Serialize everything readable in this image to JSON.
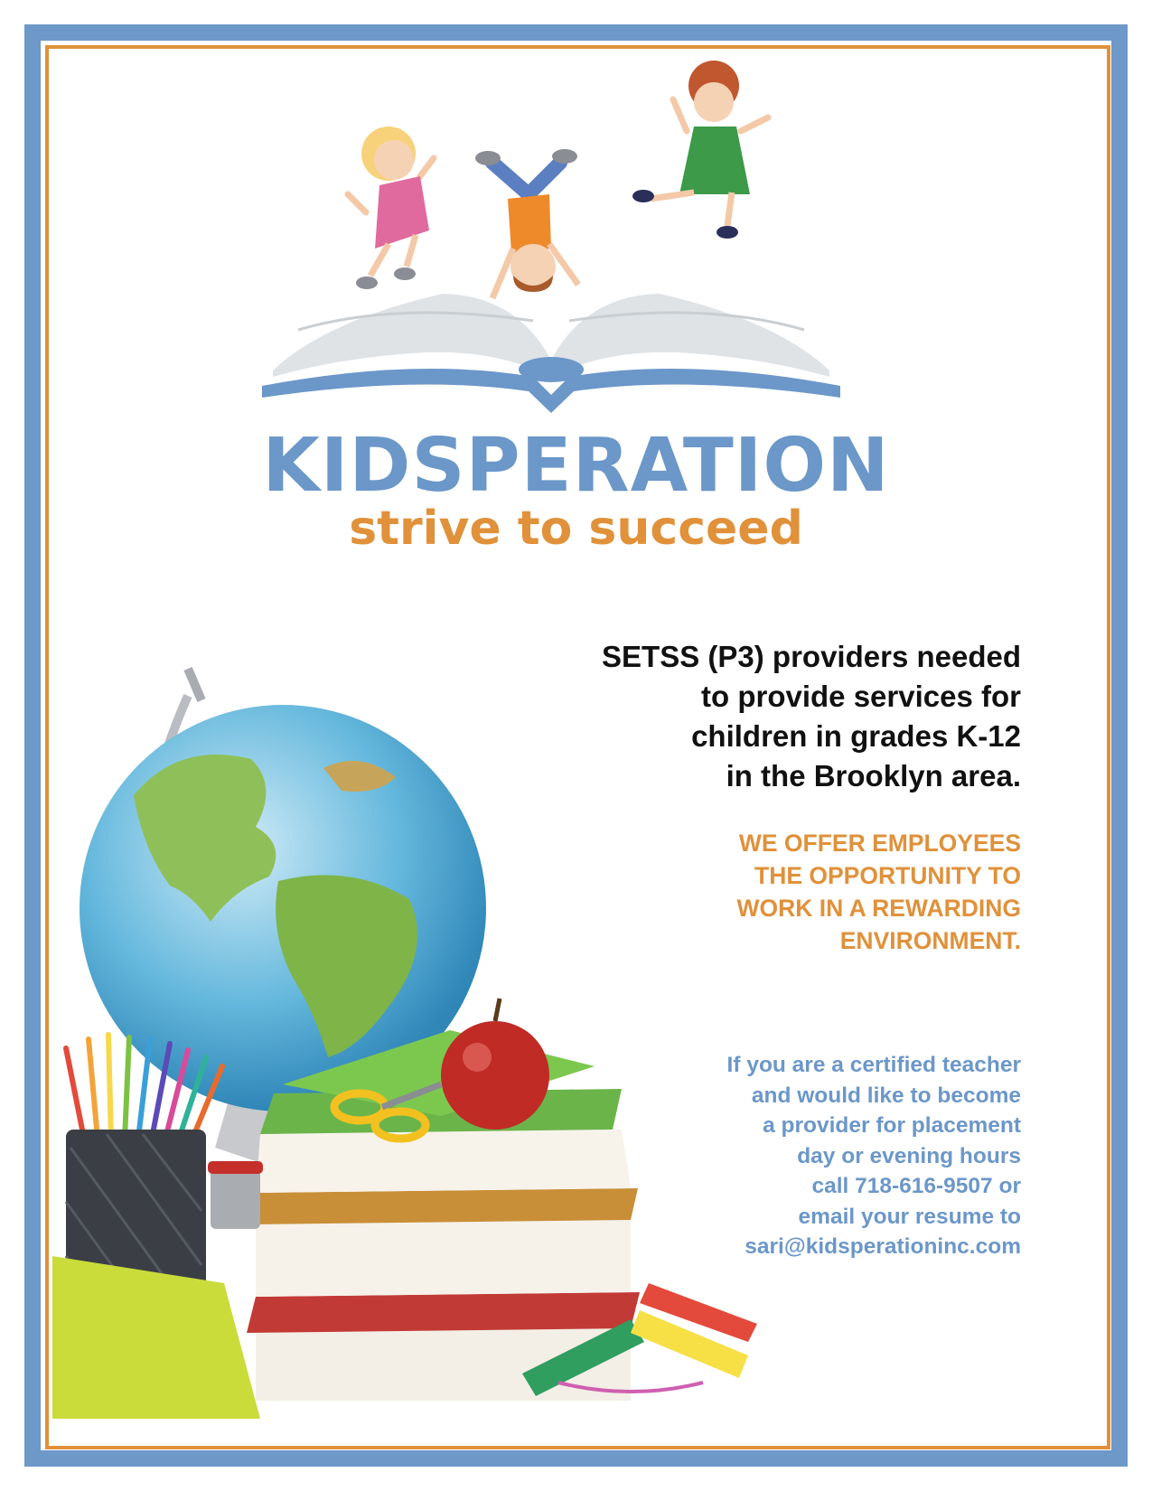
{
  "colors": {
    "frame_blue": "#6d98c8",
    "frame_orange": "#e0913a",
    "brand_blue": "#6b97c9",
    "accent_orange": "#e0913a",
    "body_text": "#111111"
  },
  "logo": {
    "brand": "KIDSPERATION",
    "tagline": "strive to succeed"
  },
  "announcement": {
    "lines": [
      "SETSS (P3) providers needed",
      "to provide services for",
      "children in grades K-12",
      "in the Brooklyn area."
    ]
  },
  "offer": {
    "lines": [
      "WE OFFER EMPLOYEES",
      "THE OPPORTUNITY TO",
      "WORK IN A REWARDING",
      "ENVIRONMENT."
    ]
  },
  "contact": {
    "lines": [
      "If you are a certified teacher",
      "and would like to become",
      "a provider for placement",
      "day or evening hours",
      "call 718-616-9507 or",
      "email your resume to",
      "sari@kidsperationinc.com"
    ]
  }
}
